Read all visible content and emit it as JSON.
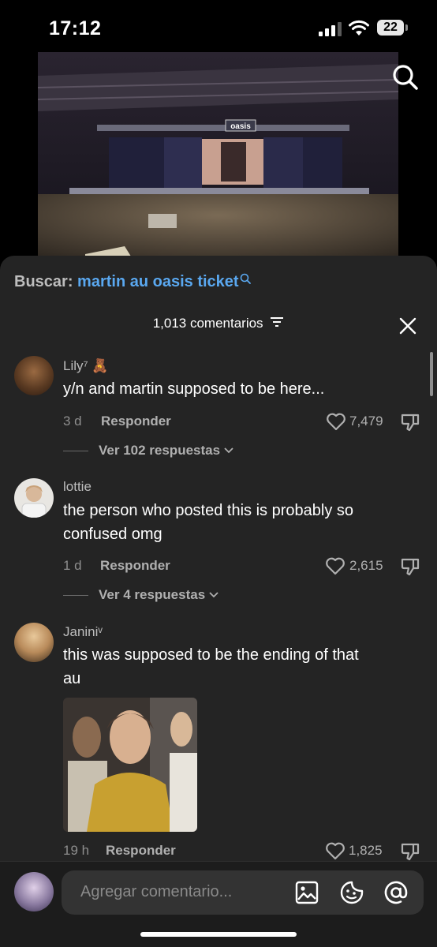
{
  "status": {
    "time": "17:12",
    "battery": "22"
  },
  "search": {
    "label": "Buscar:",
    "query": "martin au oasis ticket"
  },
  "comments_header": {
    "count": "1,013 comentarios"
  },
  "comments": [
    {
      "user": "Lily⁷ 🧸",
      "text_lines": [
        "y/n and martin supposed to be here..."
      ],
      "age": "3 d",
      "reply": "Responder",
      "likes": "7,479",
      "view_replies": "Ver 102 respuestas"
    },
    {
      "user": "lottie",
      "text_lines": [
        "the person who posted this is probably so",
        "confused omg"
      ],
      "age": "1 d",
      "reply": "Responder",
      "likes": "2,615",
      "view_replies": "Ver 4 respuestas"
    },
    {
      "user": "Janiniᵛ",
      "text_lines": [
        "this was supposed to be the ending of that",
        "au"
      ],
      "age": "19 h",
      "reply": "Responder",
      "likes": "1,825"
    }
  ],
  "composer": {
    "placeholder": "Agregar comentario..."
  },
  "video": {
    "banner": "oasis"
  }
}
